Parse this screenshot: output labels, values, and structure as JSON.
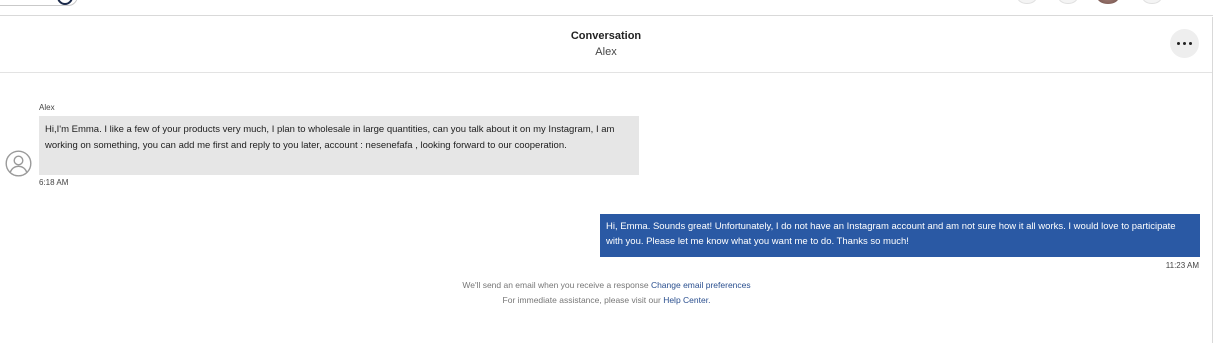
{
  "conversation": {
    "title": "Conversation",
    "subtitle": "Alex"
  },
  "messages": {
    "incoming": {
      "sender": "Alex",
      "text": "Hi,I'm Emma. I like a few of your products very much, I plan to wholesale in large quantities, can you talk about it on my Instagram, I am working on something, you can add me first and reply to you later, account : nesenefafa ,    looking forward to our cooperation.",
      "time": "6:18 AM"
    },
    "outgoing": {
      "text": "Hi, Emma. Sounds great! Unfortunately, I do not have an Instagram account and am not sure how it all works. I would love to participate with you. Please let me know what you want me to do. Thanks so much!",
      "time": "11:23 AM"
    }
  },
  "footer": {
    "email_notice": "We'll send an email when you receive a response",
    "email_link": "Change email preferences",
    "help_notice": "For immediate assistance, please visit our",
    "help_link": "Help Center."
  },
  "colors": {
    "outgoing_bubble": "#2a59a4",
    "incoming_bubble": "#e6e6e6",
    "link": "#2a4f8f"
  },
  "icons": {
    "more": "more-horizontal-icon",
    "avatar": "user-circle-icon"
  }
}
